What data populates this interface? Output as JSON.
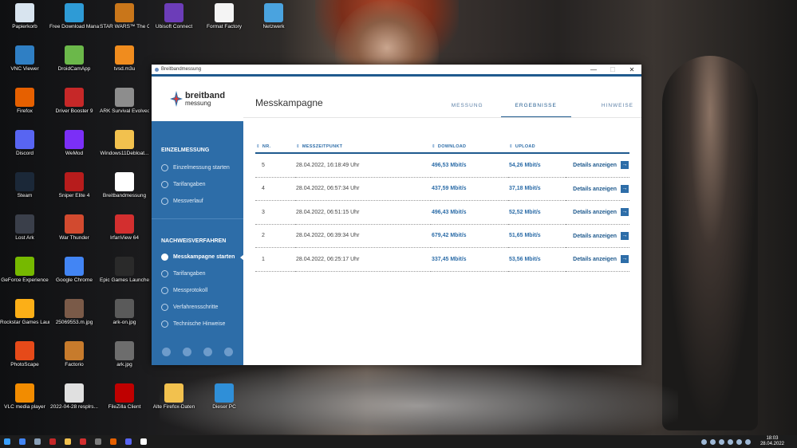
{
  "desktop": {
    "icons": [
      {
        "label": "Papierkorb",
        "color": "#d8e4ef"
      },
      {
        "label": "Free Download Manager",
        "color": "#2e9bd6"
      },
      {
        "label": "STAR WARS™ The Old Republic™",
        "color": "#c9761a"
      },
      {
        "label": "Ubisoft Connect",
        "color": "#6c3db8"
      },
      {
        "label": "Format Factory",
        "color": "#f4f4f4"
      },
      {
        "label": "Netzwerk",
        "color": "#4aa3df"
      },
      {
        "label": "VNC Viewer",
        "color": "#2f7fc4"
      },
      {
        "label": "DroidCamApp",
        "color": "#6bb84a"
      },
      {
        "label": "tvsd.m3u",
        "color": "#f08c1e"
      },
      {
        "label": "Driver Booster 9",
        "color": "#c62828"
      },
      {
        "label": "ARK Survival Evolved",
        "color": "#8d8d8d"
      },
      {
        "label": "Firefox",
        "color": "#e66000"
      },
      {
        "label": "Discord",
        "color": "#5865f2"
      },
      {
        "label": "WeMod",
        "color": "#7b2ff7"
      },
      {
        "label": "Windows11Debloat...",
        "color": "#f2c14e"
      },
      {
        "label": "Steam",
        "color": "#1b2838"
      },
      {
        "label": "Sniper Elite 4",
        "color": "#b71c1c"
      },
      {
        "label": "Breitbandmessung",
        "color": "#ffffff"
      },
      {
        "label": "Lost Ark",
        "color": "#3a3f4a"
      },
      {
        "label": "War Thunder",
        "color": "#d24a2f"
      },
      {
        "label": "IrfanView 64",
        "color": "#d32f2f"
      },
      {
        "label": "GeForce Experience",
        "color": "#76b900"
      },
      {
        "label": "Google Chrome",
        "color": "#4285f4"
      },
      {
        "label": "Epic Games Launcher",
        "color": "#2a2a2a"
      },
      {
        "label": "Rockstar Games Launcher",
        "color": "#fcaf17"
      },
      {
        "label": "25069553.m.jpg",
        "color": "#7a5a48"
      },
      {
        "label": "ark-on.jpg",
        "color": "#5a5a5a"
      },
      {
        "label": "PhotoScape",
        "color": "#e64a19"
      },
      {
        "label": "Factorio",
        "color": "#c77b2c"
      },
      {
        "label": "ark.jpg",
        "color": "#6d6d6d"
      },
      {
        "label": "VLC media player",
        "color": "#f28c00"
      },
      {
        "label": "2022-04-28 resplrs...",
        "color": "#e0e0e0"
      },
      {
        "label": "FileZilla Client",
        "color": "#bf0000"
      },
      {
        "label": "Alte Firefox-Daten",
        "color": "#f2c14e"
      },
      {
        "label": "Dieser PC",
        "color": "#2f8fd8"
      }
    ]
  },
  "window": {
    "title": "Breitbandmessung",
    "controls": {
      "minimize": "—",
      "maximize": "☐",
      "close": "✕"
    }
  },
  "sidebar": {
    "logo": {
      "word": "breitband",
      "sub": "messung"
    },
    "sections": [
      {
        "heading": "EINZELMESSUNG",
        "items": [
          {
            "label": "Einzelmessung starten"
          },
          {
            "label": "Tarifangaben"
          },
          {
            "label": "Messverlauf"
          }
        ]
      },
      {
        "heading": "NACHWEISVERFAHREN",
        "items": [
          {
            "label": "Messkampagne starten"
          },
          {
            "label": "Tarifangaben"
          },
          {
            "label": "Messprotokoll"
          },
          {
            "label": "Verfahrensschritte"
          },
          {
            "label": "Technische Hinweise"
          }
        ]
      }
    ]
  },
  "main": {
    "title": "Messkampagne",
    "tabs": [
      {
        "label": "MESSUNG"
      },
      {
        "label": "ERGEBNISSE"
      },
      {
        "label": "HINWEISE"
      }
    ],
    "active_tab": "ERGEBNISSE",
    "table": {
      "headers": {
        "nr": "NR.",
        "zeit": "MESSZEITPUNKT",
        "download": "DOWNLOAD",
        "upload": "UPLOAD"
      },
      "rows": [
        {
          "nr": "5",
          "zeit": "28.04.2022, 16:18:49 Uhr",
          "download": "496,53 Mbit/s",
          "upload": "54,26 Mbit/s",
          "details": "Details anzeigen"
        },
        {
          "nr": "4",
          "zeit": "28.04.2022, 06:57:34 Uhr",
          "download": "437,59 Mbit/s",
          "upload": "37,18 Mbit/s",
          "details": "Details anzeigen"
        },
        {
          "nr": "3",
          "zeit": "28.04.2022, 06:51:15 Uhr",
          "download": "496,43 Mbit/s",
          "upload": "52,52 Mbit/s",
          "details": "Details anzeigen"
        },
        {
          "nr": "2",
          "zeit": "28.04.2022, 06:39:34 Uhr",
          "download": "679,42 Mbit/s",
          "upload": "51,65 Mbit/s",
          "details": "Details anzeigen"
        },
        {
          "nr": "1",
          "zeit": "28.04.2022, 06:25:17 Uhr",
          "download": "337,45 Mbit/s",
          "upload": "53,56 Mbit/s",
          "details": "Details anzeigen"
        }
      ]
    }
  },
  "taskbar": {
    "clock_time": "18:03",
    "clock_date": "28.04.2022",
    "apps": [
      {
        "name": "windows-start-icon",
        "color": "#3aa0ff"
      },
      {
        "name": "chrome-icon",
        "color": "#4285f4"
      },
      {
        "name": "network-tool-icon",
        "color": "#8aa0b8"
      },
      {
        "name": "game-icon",
        "color": "#c62828"
      },
      {
        "name": "folder-icon",
        "color": "#f2c14e"
      },
      {
        "name": "record-icon",
        "color": "#d32f2f"
      },
      {
        "name": "app-icon",
        "color": "#7d7d7d"
      },
      {
        "name": "firefox-icon",
        "color": "#e66000"
      },
      {
        "name": "discord-icon",
        "color": "#5865f2"
      },
      {
        "name": "breitbandmessung-icon",
        "color": "#ffffff"
      }
    ]
  }
}
